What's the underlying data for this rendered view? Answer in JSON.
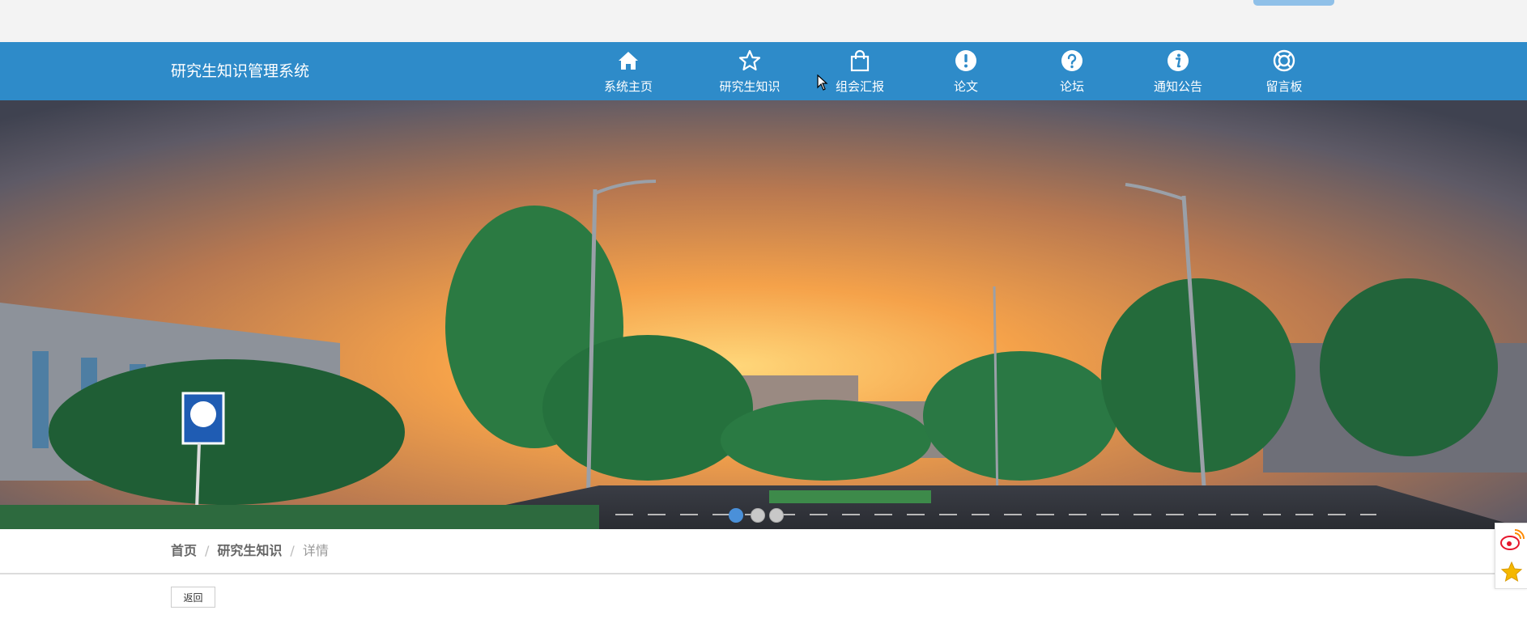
{
  "header": {
    "brand": "研究生知识管理系统",
    "nav": [
      {
        "label": "系统主页",
        "icon": "home-icon"
      },
      {
        "label": "研究生知识",
        "icon": "star-icon"
      },
      {
        "label": "组会汇报",
        "icon": "shopping-bag-icon"
      },
      {
        "label": "论文",
        "icon": "exclamation-circle-icon"
      },
      {
        "label": "论坛",
        "icon": "question-circle-icon"
      },
      {
        "label": "通知公告",
        "icon": "info-circle-icon"
      },
      {
        "label": "留言板",
        "icon": "lifebuoy-icon"
      }
    ]
  },
  "banner": {
    "slides": 3,
    "active_slide": 1
  },
  "breadcrumb": {
    "home": "首页",
    "section": "研究生知识",
    "current": "详情"
  },
  "actions": {
    "back_label": "返回"
  },
  "side_tools": [
    {
      "icon": "weibo-icon"
    },
    {
      "icon": "favorite-star-icon"
    }
  ],
  "colors": {
    "navbar": "#2e8bc9",
    "topbar": "#f3f3f3",
    "active_dot": "#4a90d9"
  }
}
